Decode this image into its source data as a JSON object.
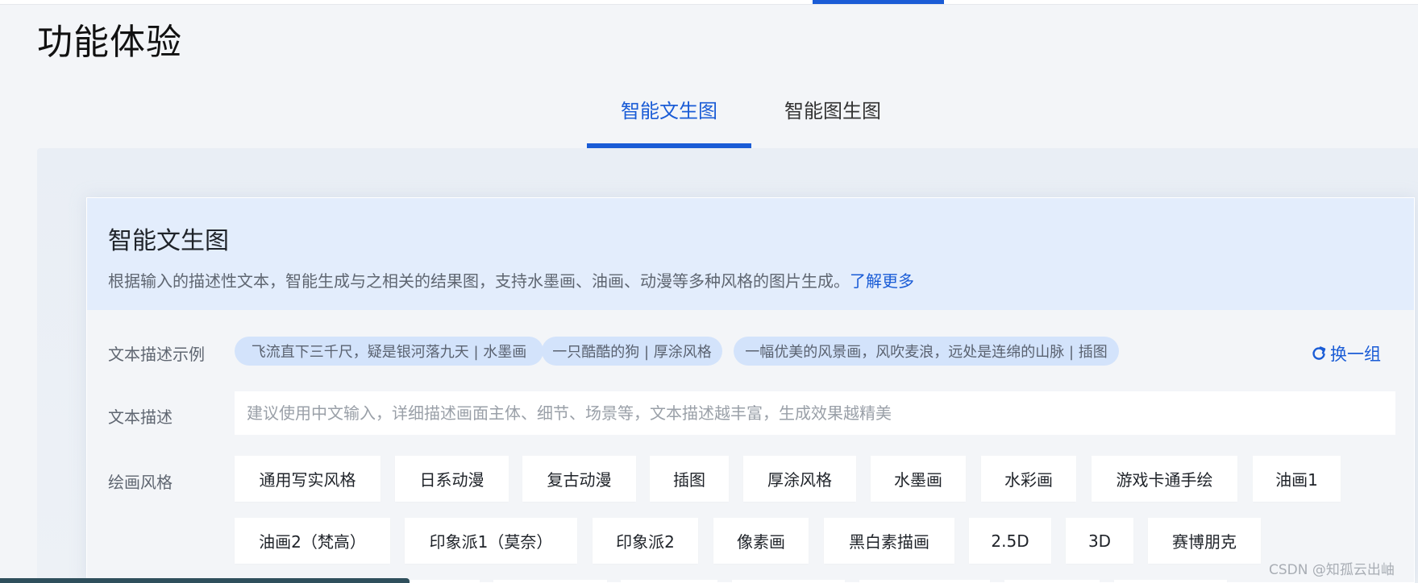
{
  "page": {
    "title": "功能体验"
  },
  "tabs": [
    {
      "label": "智能文生图",
      "active": true
    },
    {
      "label": "智能图生图",
      "active": false
    }
  ],
  "card": {
    "title": "智能文生图",
    "description": "根据输入的描述性文本，智能生成与之相关的结果图，支持水墨画、油画、动漫等多种风格的图片生成。",
    "learn_more": "了解更多"
  },
  "examples": {
    "label": "文本描述示例",
    "items": [
      "飞流直下三千尺，疑是银河落九天 | 水墨画",
      "一只酷酷的狗 | 厚涂风格",
      "一幅优美的风景画，风吹麦浪，远处是连绵的山脉 | 插图"
    ],
    "refresh_label": "换一组",
    "refresh_icon": "refresh-icon"
  },
  "text_input": {
    "label": "文本描述",
    "value": "",
    "placeholder": "建议使用中文输入，详细描述画面主体、细节、场景等，文本描述越丰富，生成效果越精美"
  },
  "styles": {
    "label": "绘画风格",
    "row1": [
      "通用写实风格",
      "日系动漫",
      "复古动漫",
      "插图",
      "厚涂风格",
      "水墨画",
      "水彩画",
      "游戏卡通手绘",
      "油画1"
    ],
    "row2": [
      "油画2（梵高）",
      "印象派1（莫奈）",
      "印象派2",
      "像素画",
      "黑白素描画",
      "2.5D",
      "3D",
      "赛博朋克"
    ]
  },
  "watermark": "CSDN @知孤云出岫",
  "colors": {
    "accent": "#1a5cd6",
    "chip_bg": "#d3e3fb",
    "header_bg": "#e3edfc"
  }
}
